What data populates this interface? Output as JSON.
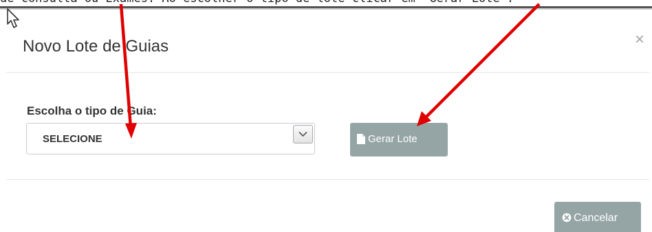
{
  "caption": {
    "text": "de consulta ou Exames. Ao escolher o tipo de lote clicar em \"Gerar Lote\"."
  },
  "modal": {
    "title": "Novo Lote de Guias",
    "close_glyph": "×"
  },
  "form": {
    "label": "Escolha o tipo de Guia:",
    "select": {
      "selected_value": "SELECIONE"
    }
  },
  "buttons": {
    "generate_label": "Gerar Lote",
    "generate_icon": "file-icon",
    "cancel_label": "Cancelar",
    "cancel_icon": "circle-x-icon"
  },
  "colors": {
    "button_bg": "#95a5a6",
    "annotation_arrow": "#e00000"
  }
}
